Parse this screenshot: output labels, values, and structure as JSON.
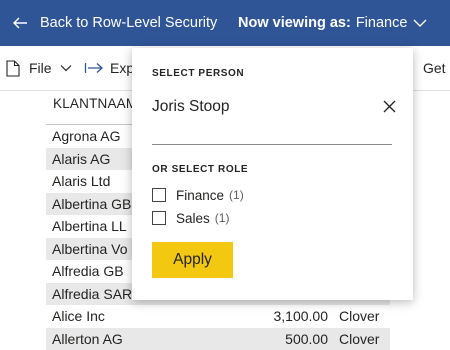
{
  "topbar": {
    "back_label": "Back to Row-Level Security",
    "viewing_prefix": "Now viewing as:",
    "viewing_role": "Finance",
    "background": "#2f5597"
  },
  "toolbar": {
    "file_label": "File",
    "export_label": "Exp",
    "get_label": "Get"
  },
  "table": {
    "column_header": "KLANTNAAM",
    "rows": [
      {
        "name": "Agrona AG",
        "amount": "",
        "city": ""
      },
      {
        "name": "Alaris AG",
        "amount": "",
        "city": ""
      },
      {
        "name": "Alaris Ltd",
        "amount": "",
        "city": ""
      },
      {
        "name": "Albertina GB",
        "amount": "",
        "city": ""
      },
      {
        "name": "Albertina LL",
        "amount": "",
        "city": ""
      },
      {
        "name": "Albertina Vo",
        "amount": "",
        "city": ""
      },
      {
        "name": "Alfredia GB",
        "amount": "",
        "city": ""
      },
      {
        "name": "Alfredia SAR",
        "amount": "",
        "city": ""
      },
      {
        "name": "Alice Inc",
        "amount": "3,100.00",
        "city": "Clover"
      },
      {
        "name": "Allerton AG",
        "amount": "500.00",
        "city": "Clover"
      }
    ]
  },
  "popup": {
    "select_person_title": "SELECT PERSON",
    "person_value": "Joris Stoop",
    "select_role_title": "OR SELECT ROLE",
    "roles": [
      {
        "label": "Finance",
        "count": "(1)",
        "checked": false
      },
      {
        "label": "Sales",
        "count": "(1)",
        "checked": false
      }
    ],
    "apply_label": "Apply",
    "apply_color": "#f2c811"
  },
  "icons": {
    "back": "arrow-left-icon",
    "viewing_dropdown": "chevron-down-icon",
    "file": "document-icon",
    "file_dropdown": "chevron-down-icon",
    "export": "export-arrow-icon",
    "clear": "close-icon"
  }
}
